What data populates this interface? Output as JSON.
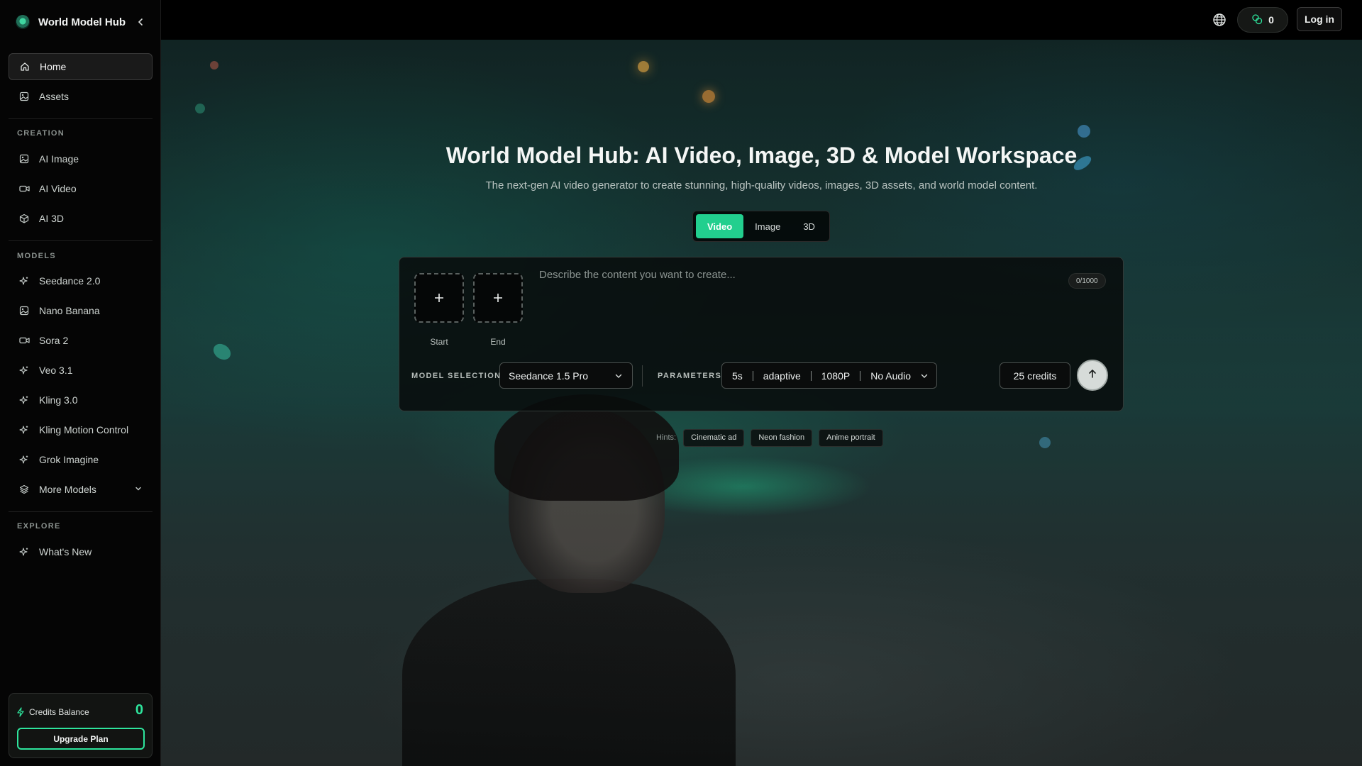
{
  "brand": {
    "name": "World Model Hub"
  },
  "sidebar": {
    "top_items": [
      {
        "label": "Home",
        "icon": "home-icon",
        "active": true
      },
      {
        "label": "Assets",
        "icon": "image-icon"
      }
    ],
    "sections": [
      {
        "title": "CREATION",
        "items": [
          {
            "label": "AI Image",
            "icon": "image-icon"
          },
          {
            "label": "AI Video",
            "icon": "video-icon"
          },
          {
            "label": "AI 3D",
            "icon": "cube-icon"
          }
        ]
      },
      {
        "title": "MODELS",
        "items": [
          {
            "label": "Seedance 2.0",
            "icon": "sparkle-icon"
          },
          {
            "label": "Nano Banana",
            "icon": "image-icon"
          },
          {
            "label": "Sora 2",
            "icon": "video-icon"
          },
          {
            "label": "Veo 3.1",
            "icon": "sparkle-icon"
          },
          {
            "label": "Kling 3.0",
            "icon": "sparkle-icon"
          },
          {
            "label": "Kling Motion Control",
            "icon": "sparkle-icon"
          },
          {
            "label": "Grok Imagine",
            "icon": "sparkle-icon"
          },
          {
            "label": "More Models",
            "icon": "layers-icon"
          }
        ]
      },
      {
        "title": "EXPLORE",
        "items": [
          {
            "label": "What's New",
            "icon": "sparkle-icon"
          }
        ]
      }
    ],
    "credits": {
      "label": "Credits Balance",
      "value": "0",
      "upgrade_label": "Upgrade Plan"
    }
  },
  "topbar": {
    "points": "0",
    "login_label": "Log in"
  },
  "hero": {
    "title": "World Model Hub: AI Video, Image, 3D & Model Workspace",
    "subtitle": "The next-gen AI video generator to create stunning, high-quality videos, images, 3D assets, and world model content.",
    "tabs": [
      "Video",
      "Image",
      "3D"
    ],
    "active_tab": "Video"
  },
  "composer": {
    "start_label": "Start",
    "end_label": "End",
    "prompt_placeholder": "Describe the content you want to create...",
    "prompt_value": "",
    "char_count": "0/1000",
    "model_selection_label": "MODEL SELECTION",
    "model_value": "Seedance 1.5 Pro",
    "parameters_label": "PARAMETERS",
    "params": {
      "duration": "5s",
      "ratio": "adaptive",
      "resolution": "1080P",
      "audio": "No Audio"
    },
    "credits_label": "25 credits"
  },
  "hints": {
    "label": "Hints:",
    "items": [
      "Cinematic ad",
      "Neon fashion",
      "Anime portrait"
    ]
  },
  "colors": {
    "accent": "#22cf8e",
    "credits_green": "#2ee59d",
    "background": "#000000"
  }
}
